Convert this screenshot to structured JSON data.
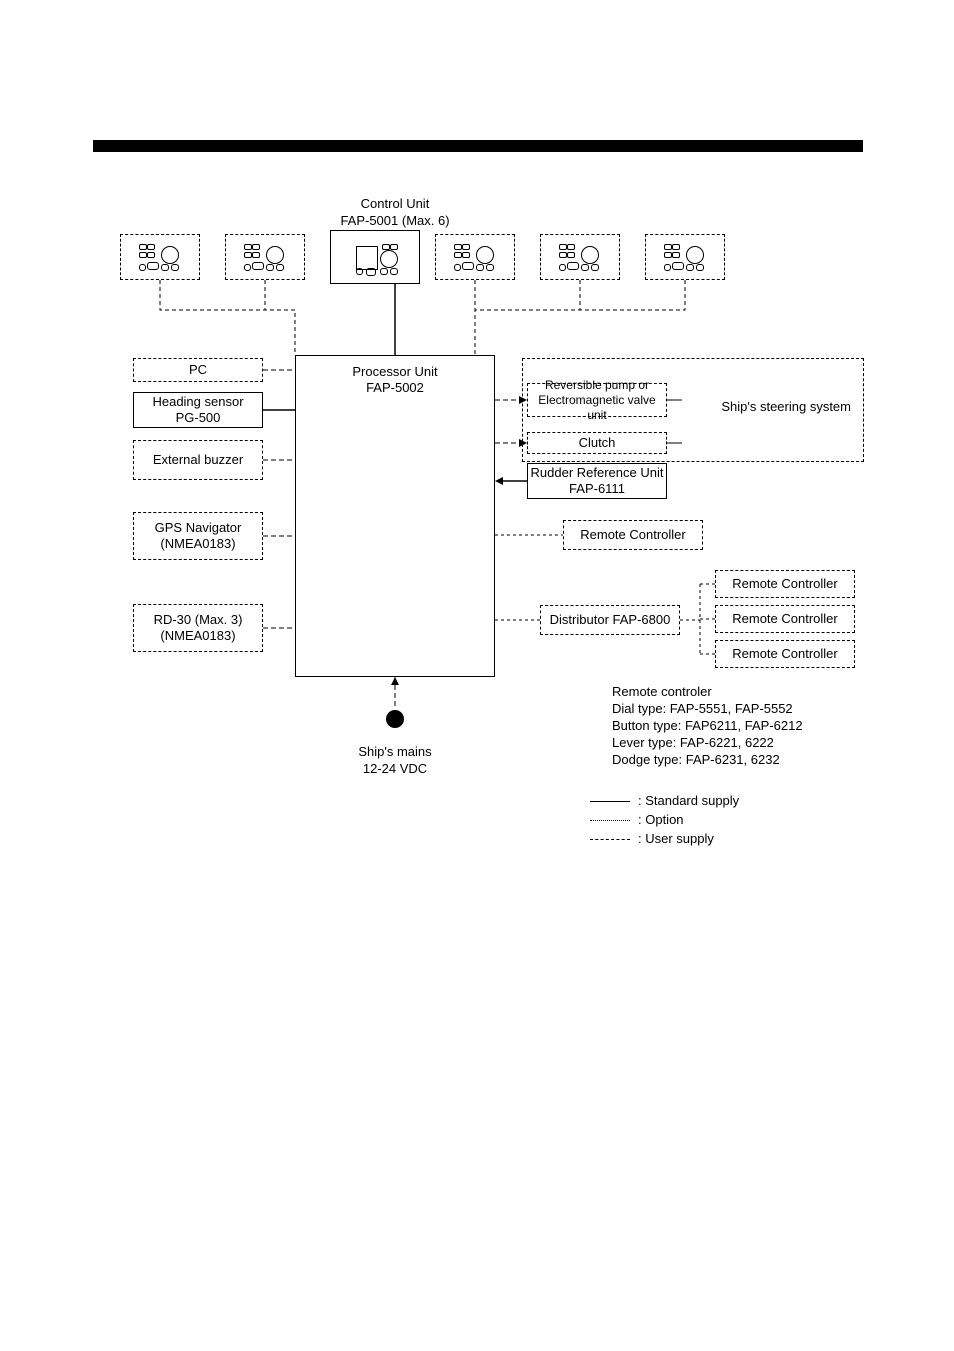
{
  "title_line1": "Control Unit",
  "title_line2": "FAP-5001 (Max. 6)",
  "processor_line1": "Processor Unit",
  "processor_line2": "FAP-5002",
  "left": {
    "pc": "PC",
    "heading_line1": "Heading sensor",
    "heading_line2": "PG-500",
    "buzzer": "External buzzer",
    "gps_line1": "GPS Navigator",
    "gps_line2": "(NMEA0183)",
    "rd30_line1": "RD-30 (Max. 3)",
    "rd30_line2": "(NMEA0183)"
  },
  "right": {
    "rev_line1": "Reversible pump or",
    "rev_line2": "Electromagnetic valve unit",
    "clutch": "Clutch",
    "rru_line1": "Rudder Reference Unit",
    "rru_line2": "FAP-6111",
    "remote1": "Remote Controller",
    "distributor": "Distributor FAP-6800",
    "remote2a": "Remote Controller",
    "remote2b": "Remote Controller",
    "remote2c": "Remote Controller",
    "steering": "Ship's steering system"
  },
  "mains_line1": "Ship's mains",
  "mains_line2": "12-24 VDC",
  "note": {
    "l1": "Remote controler",
    "l2": "Dial type: FAP-5551, FAP-5552",
    "l3": "Button type: FAP6211, FAP-6212",
    "l4": "Lever type: FAP-6221, 6222",
    "l5": "Dodge type: FAP-6231, 6232"
  },
  "legend": {
    "standard": ": Standard supply",
    "option": ": Option",
    "user": ": User supply"
  }
}
